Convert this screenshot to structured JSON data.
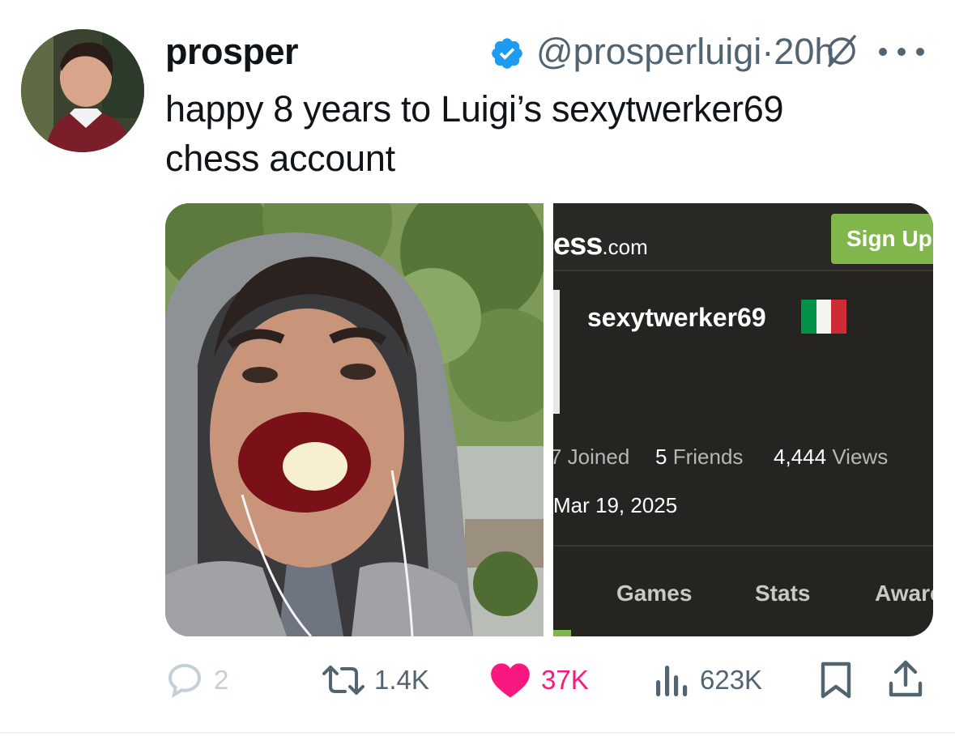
{
  "tweet": {
    "author_name": "prosper",
    "handle": "@prosperluigi",
    "separator": "·",
    "time": "20h",
    "text_line1": "happy 8 years to Luigi’s sexytwerker69",
    "text_line2": "chess account"
  },
  "icons": {
    "verified": "verified-badge-icon",
    "grok": "grok-icon",
    "more": "more-icon",
    "reply": "reply-icon",
    "retweet": "retweet-icon",
    "like": "heart-icon",
    "views": "views-icon",
    "bookmark": "bookmark-icon",
    "share": "share-icon"
  },
  "embedded_screenshot": {
    "logo_main": "ess",
    "logo_suffix": ".com",
    "signup_label": "Sign Up",
    "username": "sexytwerker69",
    "joined_label": "7 Joined",
    "friends_count": "5",
    "friends_label": "Friends",
    "views_count": "4,444",
    "views_label": "Views",
    "joined_date": "Mar 19, 2025",
    "tabs": [
      "Games",
      "Stats",
      "Aware"
    ]
  },
  "actions": {
    "replies": "2",
    "retweets": "1.4K",
    "likes": "37K",
    "views": "623K"
  },
  "colors": {
    "verified_blue": "#1d9bf0",
    "like_pink": "#f91880",
    "muted_gray": "#536471",
    "chess_green": "#81b64c",
    "chess_dark": "#262421",
    "flag_green": "#009246",
    "flag_red": "#ce2b37"
  }
}
